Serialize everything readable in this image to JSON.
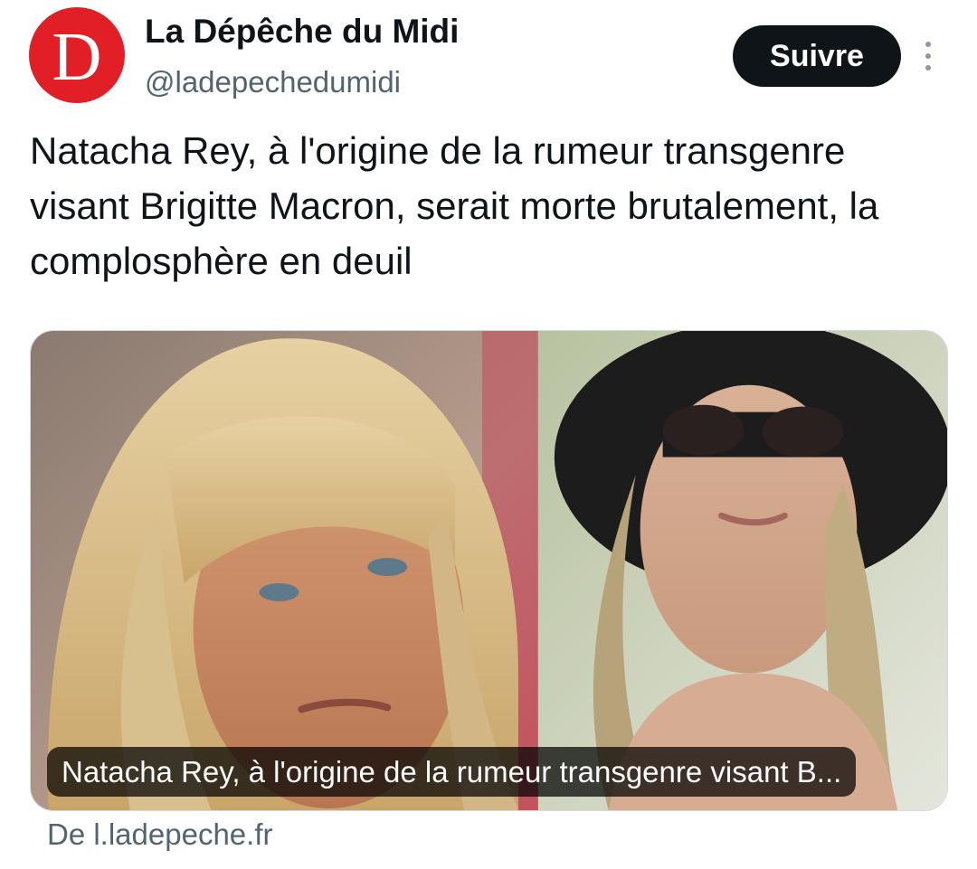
{
  "account": {
    "display_name": "La Dépêche du Midi",
    "handle": "@ladepechedumidi",
    "avatar_letter": "D",
    "avatar_color": "#e21f26"
  },
  "actions": {
    "follow_label": "Suivre",
    "more_icon": "more-vertical-icon"
  },
  "tweet": {
    "text": "Natacha Rey, à l'origine de la rumeur transgenre visant Brigitte Macron, serait morte brutalement, la complosphère en deuil"
  },
  "link_card": {
    "caption": "Natacha Rey, à l'origine de la rumeur transgenre visant B...",
    "source": "De l.ladepeche.fr"
  },
  "colors": {
    "text_primary": "#0f1419",
    "text_secondary": "#536471",
    "button_bg": "#0f1419",
    "card_border": "#cfd9de"
  }
}
